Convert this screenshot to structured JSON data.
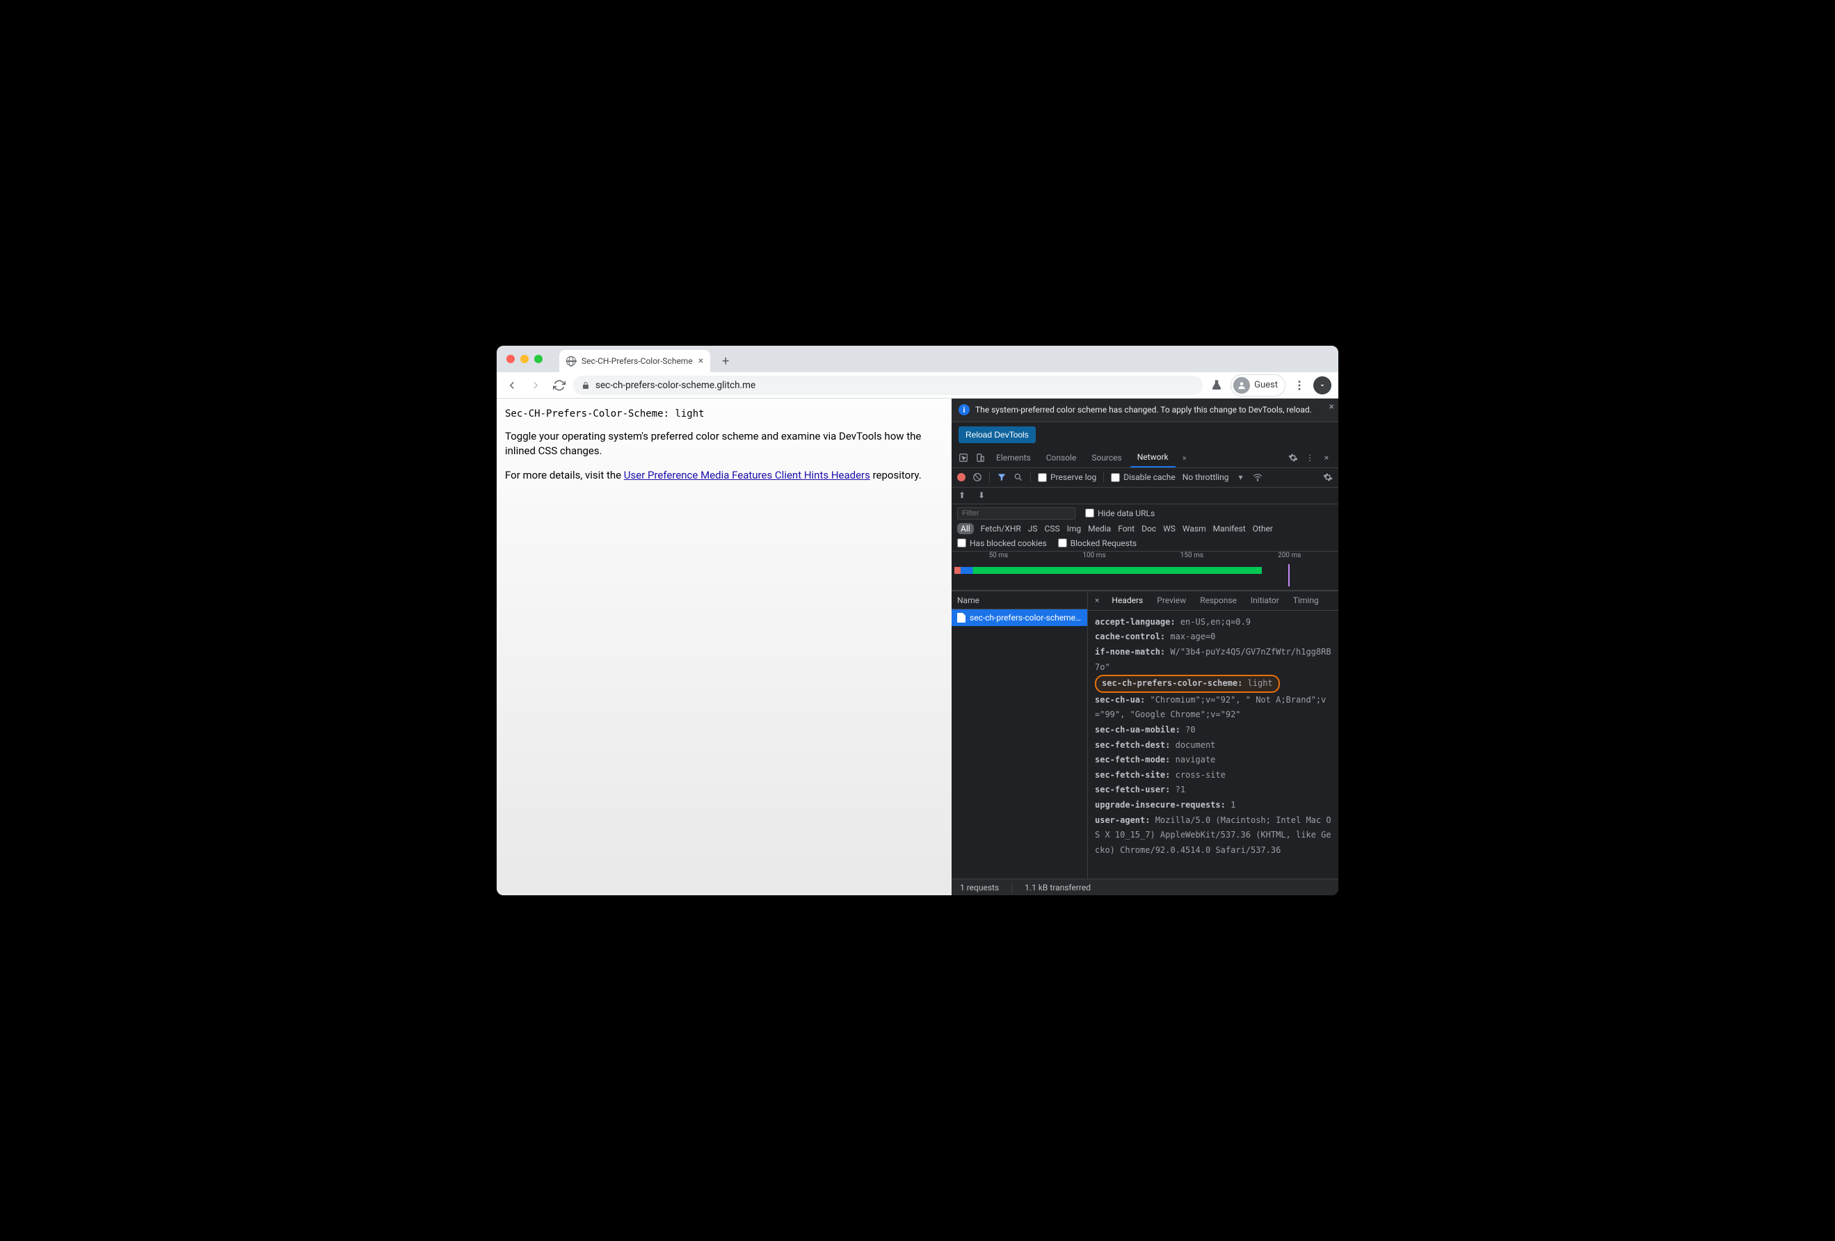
{
  "window": {
    "tab_title": "Sec-CH-Prefers-Color-Scheme",
    "url": "sec-ch-prefers-color-scheme.glitch.me",
    "guest_label": "Guest"
  },
  "page": {
    "header_line": "Sec-CH-Prefers-Color-Scheme: light",
    "para1": "Toggle your operating system's preferred color scheme and examine via DevTools how the inlined CSS changes.",
    "para2_prefix": "For more details, visit the ",
    "para2_link": "User Preference Media Features Client Hints Headers",
    "para2_suffix": " repository."
  },
  "devtools": {
    "banner": "The system-preferred color scheme has changed. To apply this change to DevTools, reload.",
    "reload_label": "Reload DevTools",
    "tabs": {
      "elements": "Elements",
      "console": "Console",
      "sources": "Sources",
      "network": "Network"
    },
    "net_toolbar": {
      "preserve_log": "Preserve log",
      "disable_cache": "Disable cache",
      "throttling": "No throttling"
    },
    "filter_placeholder": "Filter",
    "hide_data_urls": "Hide data URLs",
    "type_chips": [
      "All",
      "Fetch/XHR",
      "JS",
      "CSS",
      "Img",
      "Media",
      "Font",
      "Doc",
      "WS",
      "Wasm",
      "Manifest",
      "Other"
    ],
    "blocked_cookies": "Has blocked cookies",
    "blocked_requests": "Blocked Requests",
    "timeline_ticks": [
      "50 ms",
      "100 ms",
      "150 ms",
      "200 ms"
    ],
    "name_header": "Name",
    "request_name": "sec-ch-prefers-color-scheme…",
    "detail_tabs": {
      "headers": "Headers",
      "preview": "Preview",
      "response": "Response",
      "initiator": "Initiator",
      "timing": "Timing"
    },
    "headers": [
      {
        "k": "accept-language:",
        "v": " en-US,en;q=0.9"
      },
      {
        "k": "cache-control:",
        "v": " max-age=0"
      },
      {
        "k": "if-none-match:",
        "v": " W/\"3b4-puYz4Q5/GV7nZfWtr/h1gg8RB7o\""
      },
      {
        "k": "sec-ch-prefers-color-scheme:",
        "v": " light",
        "hl": true
      },
      {
        "k": "sec-ch-ua:",
        "v": " \"Chromium\";v=\"92\", \" Not A;Brand\";v=\"99\", \"Google Chrome\";v=\"92\""
      },
      {
        "k": "sec-ch-ua-mobile:",
        "v": " ?0"
      },
      {
        "k": "sec-fetch-dest:",
        "v": " document"
      },
      {
        "k": "sec-fetch-mode:",
        "v": " navigate"
      },
      {
        "k": "sec-fetch-site:",
        "v": " cross-site"
      },
      {
        "k": "sec-fetch-user:",
        "v": " ?1"
      },
      {
        "k": "upgrade-insecure-requests:",
        "v": " 1"
      },
      {
        "k": "user-agent:",
        "v": " Mozilla/5.0 (Macintosh; Intel Mac OS X 10_15_7) AppleWebKit/537.36 (KHTML, like Gecko) Chrome/92.0.4514.0 Safari/537.36"
      }
    ],
    "status": {
      "requests": "1 requests",
      "transferred": "1.1 kB transferred"
    }
  }
}
